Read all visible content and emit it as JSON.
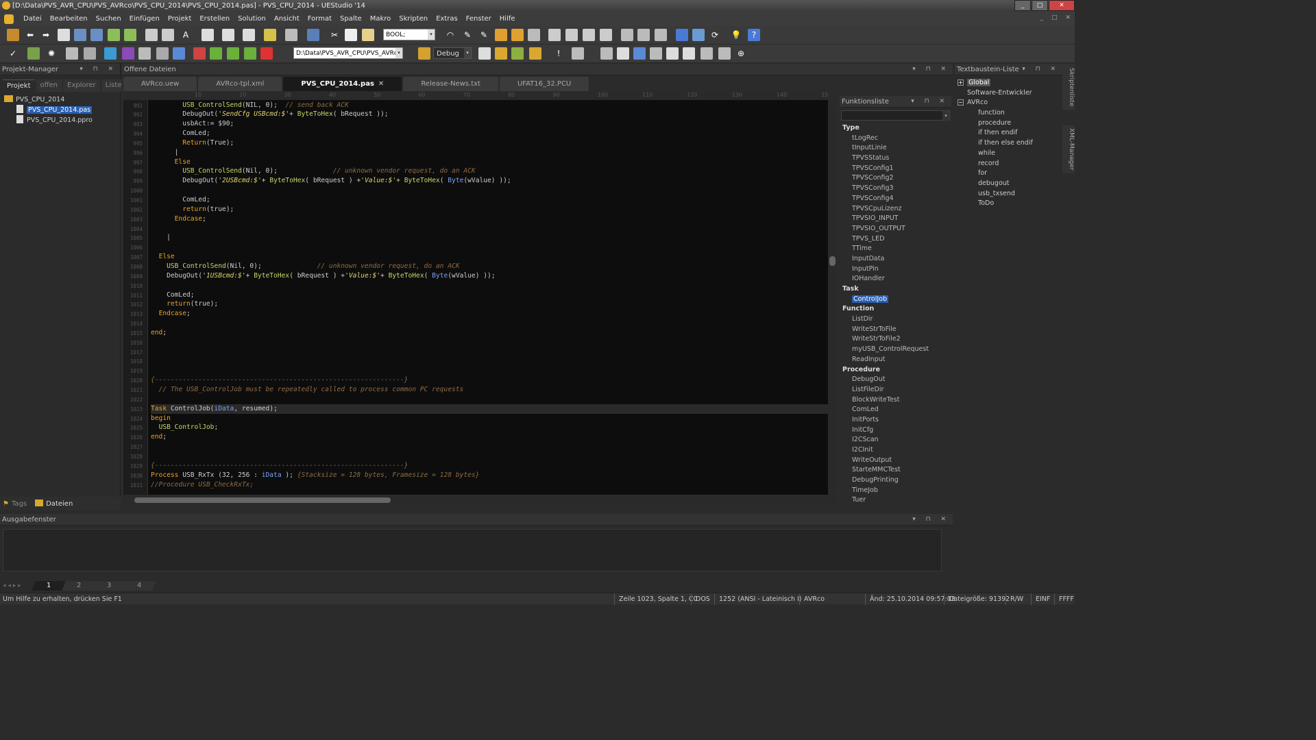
{
  "window": {
    "title": "[D:\\Data\\PVS_AVR_CPU\\PVS_AVRco\\PVS_CPU_2014\\PVS_CPU_2014.pas] - PVS_CPU_2014 - UEStudio '14"
  },
  "menu": [
    "Datei",
    "Bearbeiten",
    "Suchen",
    "Einfügen",
    "Projekt",
    "Erstellen",
    "Solution",
    "Ansicht",
    "Format",
    "Spalte",
    "Makro",
    "Skripten",
    "Extras",
    "Fenster",
    "Hilfe"
  ],
  "toolbar": {
    "type_combo": "BOOL;",
    "path_combo": "D:\\Data\\PVS_AVR_CPU\\PVS_AVRco",
    "config_combo": "Debug"
  },
  "project_manager": {
    "title": "Projekt-Manager",
    "tabs": [
      "Projekt",
      "offen",
      "Explorer",
      "Listen"
    ],
    "root": "PVS_CPU_2014",
    "files": [
      "PVS_CPU_2014.pas",
      "PVS_CPU_2014.ppro"
    ],
    "bottom_tabs": [
      "Tags",
      "Dateien"
    ]
  },
  "editor": {
    "panel_title": "Offene Dateien",
    "tabs": [
      {
        "label": "AVRco.uew"
      },
      {
        "label": "AVRco-tpl.xml"
      },
      {
        "label": "PVS_CPU_2014.pas",
        "active": true
      },
      {
        "label": "Release-News.txt"
      },
      {
        "label": "UFAT16_32.PCU"
      }
    ],
    "ruler": [
      "10",
      "20",
      "30",
      "40",
      "50",
      "60",
      "70",
      "80",
      "90",
      "100",
      "110",
      "120",
      "130",
      "140",
      "15"
    ],
    "lines": [
      {
        "n": "991",
        "html": "        <span class='fn'>USB_ControlSend</span>(NIL, 0);  <span class='cm'>// send back ACK</span>"
      },
      {
        "n": "992",
        "html": "        DebugOut(<span class='str'>'SendCfg USBcmd:$'</span>+ <span class='fn'>ByteToHex</span>( bRequest ));"
      },
      {
        "n": "993",
        "html": "        usbAct:= $90;"
      },
      {
        "n": "994",
        "html": "        ComLed;"
      },
      {
        "n": "995",
        "html": "        <span class='kw'>Return</span>(True);"
      },
      {
        "n": "996",
        "html": "      |"
      },
      {
        "n": "997",
        "html": "      <span class='kw'>Else</span>"
      },
      {
        "n": "998",
        "html": "        <span class='fn'>USB_ControlSend</span>(Nil, 0);              <span class='cm'>// unknown vendor request, do an ACK</span>"
      },
      {
        "n": "999",
        "html": "        DebugOut(<span class='str'>'2USBcmd:$'</span>+ <span class='fn'>ByteToHex</span>( bRequest ) +<span class='str'>'Value:$'</span>+ <span class='fn'>ByteToHex</span>( <span class='typ'>Byte</span>(wValue) ));"
      },
      {
        "n": "1000",
        "html": ""
      },
      {
        "n": "1001",
        "html": "        ComLed;"
      },
      {
        "n": "1002",
        "html": "        <span class='kw'>return</span>(true);"
      },
      {
        "n": "1003",
        "html": "      <span class='kw'>Endcase</span>;"
      },
      {
        "n": "1004",
        "html": ""
      },
      {
        "n": "1005",
        "html": "    |"
      },
      {
        "n": "1006",
        "html": ""
      },
      {
        "n": "1007",
        "html": "  <span class='kw'>Else</span>"
      },
      {
        "n": "1008",
        "html": "    <span class='fn'>USB_ControlSend</span>(Nil, 0);              <span class='cm'>// unknown vendor request, do an ACK</span>"
      },
      {
        "n": "1009",
        "html": "    DebugOut(<span class='str'>'1USBcmd:$'</span>+ <span class='fn'>ByteToHex</span>( bRequest ) +<span class='str'>'Value:$'</span>+ <span class='fn'>ByteToHex</span>( <span class='typ'>Byte</span>(wValue) ));"
      },
      {
        "n": "1010",
        "html": ""
      },
      {
        "n": "1011",
        "html": "    ComLed;"
      },
      {
        "n": "1012",
        "html": "    <span class='kw'>return</span>(true);"
      },
      {
        "n": "1013",
        "html": "  <span class='kw'>Endcase</span>;"
      },
      {
        "n": "1014",
        "html": ""
      },
      {
        "n": "1015",
        "html": "<span class='kw'>end</span>;"
      },
      {
        "n": "1016",
        "html": ""
      },
      {
        "n": "1017",
        "html": ""
      },
      {
        "n": "1018",
        "html": ""
      },
      {
        "n": "1019",
        "html": ""
      },
      {
        "n": "1020",
        "html": "<span class='cm'>{---------------------------------------------------------------}</span>"
      },
      {
        "n": "1021",
        "html": "  <span class='cm'>// The USB_ControlJob must be repeatedly called to process common PC requests</span>"
      },
      {
        "n": "1022",
        "html": ""
      },
      {
        "n": "1023",
        "html": "<span class='kw'>Task</span> ControlJob(<span class='typ'>iData</span>, resumed);",
        "current": true
      },
      {
        "n": "1024",
        "html": "<span class='kw'>begin</span>"
      },
      {
        "n": "1025",
        "html": "  <span class='fn'>USB_ControlJob</span>;"
      },
      {
        "n": "1026",
        "html": "<span class='kw'>end</span>;"
      },
      {
        "n": "1027",
        "html": ""
      },
      {
        "n": "1028",
        "html": ""
      },
      {
        "n": "1029",
        "html": "<span class='cm'>{---------------------------------------------------------------}</span>"
      },
      {
        "n": "1030",
        "html": "<span class='kw'>Process</span> USB_RxTx (32, 256 : <span class='typ'>iData</span> ); <span class='cm'>{Stacksize = 128 bytes, Framesize = 128 bytes}</span>"
      },
      {
        "n": "1031",
        "html": "<span class='cm'>//Procedure USB_CheckRxTx;</span>"
      }
    ]
  },
  "function_list": {
    "title": "Funktionsliste",
    "groups": [
      {
        "name": "Type",
        "items": [
          "tLogRec",
          "tInputLinie",
          "TPVSStatus",
          "TPVSConfig1",
          "TPVSConfig2",
          "TPVSConfig3",
          "TPVSConfig4",
          "TPVSCpuLizenz",
          "TPVSIO_INPUT",
          "TPVSIO_OUTPUT",
          "TPVS_LED",
          "TTime",
          "InputData",
          "InputPin",
          "IOHandler"
        ]
      },
      {
        "name": "Task",
        "items": [
          "ControlJob"
        ],
        "selected": "ControlJob"
      },
      {
        "name": "Function",
        "items": [
          "ListDir",
          "WriteStrToFile",
          "WriteStrToFile2",
          "myUSB_ControlRequest",
          "ReadInput"
        ]
      },
      {
        "name": "Procedure",
        "items": [
          "DebugOut",
          "ListFileDir",
          "BlockWriteTest",
          "ComLed",
          "InitPorts",
          "InitCfg",
          "I2CScan",
          "I2CInit",
          "WriteOutput",
          "StarteMMCTest",
          "DebugPrinting",
          "TimeJob",
          "Tuer"
        ]
      }
    ]
  },
  "textbaustein": {
    "title": "Textbaustein-Liste",
    "global": "Global",
    "global_child": "Software-Entwickler",
    "avrco": "AVRco",
    "avrco_items": [
      "function",
      "procedure",
      "if then endif",
      "if then else endif",
      "while",
      "record",
      "for",
      "debugout",
      "usb_txsend",
      "ToDo"
    ]
  },
  "side_tabs": [
    "Skriptenliste",
    "XML-Manager"
  ],
  "output": {
    "title": "Ausgabefenster",
    "tabs": [
      "1",
      "2",
      "3",
      "4"
    ]
  },
  "status": {
    "help": "Um Hilfe zu erhalten, drücken Sie F1",
    "position": "Zeile 1023, Spalte 1, C0",
    "eol": "DOS",
    "encoding": "1252  (ANSI - Lateinisch I)",
    "lang": "AVRco",
    "modified": "Änd: 25.10.2014 09:57:03",
    "filesize": "Dateigröße: 91392",
    "rw": "R/W",
    "ins": "EINF",
    "extra": "FFFF"
  },
  "colors": {
    "keyword": "#e8a32b",
    "function": "#c8d86b",
    "string": "#e6d570",
    "comment": "#8f6c45",
    "type": "#7aa2f7",
    "selection": "#2a5fb0"
  }
}
